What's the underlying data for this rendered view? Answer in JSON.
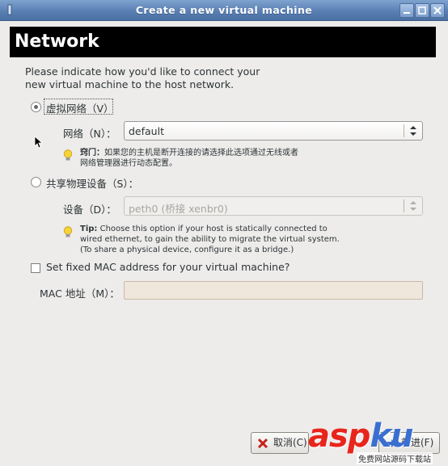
{
  "window": {
    "title": "Create a new virtual machine"
  },
  "banner": {
    "title": "Network"
  },
  "intro": {
    "line1": "Please indicate how you'd like to connect your",
    "line2": "new virtual machine to the host network."
  },
  "virtual_network": {
    "label": "虚拟网络（V）",
    "selected": true,
    "network_label": "网络（N）：",
    "network_value": "default",
    "tip_bold": "窍门：",
    "tip_line1": "如果您的主机是断开连接的请选择此选项通过无线或者",
    "tip_line2": "网络管理器进行动态配置。"
  },
  "shared_device": {
    "label": "共享物理设备（S）：",
    "selected": false,
    "device_label": "设备（D）：",
    "device_value": "peth0 (桥接 xenbr0)",
    "tip_bold": "Tip:",
    "tip_line1": " Choose this option if your host is statically connected to",
    "tip_line2": "wired ethernet, to gain the ability to migrate the virtual system.",
    "tip_line3": "(To share a physical device, configure it as a bridge.)"
  },
  "mac": {
    "checkbox_label": "Set fixed MAC address for your virtual machine?",
    "checked": false,
    "field_label": "MAC 地址（M）：",
    "field_value": ""
  },
  "footer": {
    "cancel_label": "取消(C)",
    "forward_label": "前进(F)"
  },
  "watermark": {
    "text_a": "asp",
    "text_b": "ku",
    "sub": "免费网站源码下载站"
  },
  "colors": {
    "titlebar": "#5a7fb3",
    "banner_bg": "#000000",
    "dialog_bg": "#edeceb",
    "entry_bg": "#efe6dc"
  }
}
